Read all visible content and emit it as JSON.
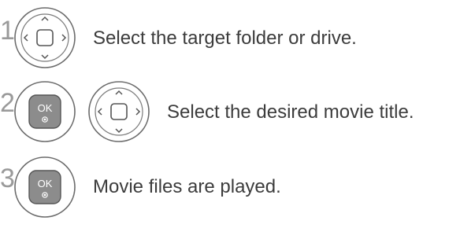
{
  "steps": [
    {
      "number": "1",
      "buttons": [
        "nav-pad"
      ],
      "text": "Select the target folder or drive."
    },
    {
      "number": "2",
      "buttons": [
        "ok",
        "nav-pad"
      ],
      "text": "Select the desired movie title."
    },
    {
      "number": "3",
      "buttons": [
        "ok"
      ],
      "text": "Movie files are played."
    }
  ],
  "ok_label": "OK",
  "icons": {
    "nav": "nav-pad-icon",
    "ok": "ok-button-icon"
  },
  "colors": {
    "step_number": "#9a9a9a",
    "text": "#3c3c3c",
    "button_outline": "#6a6a6a",
    "ok_fill": "#8c8c8c"
  }
}
